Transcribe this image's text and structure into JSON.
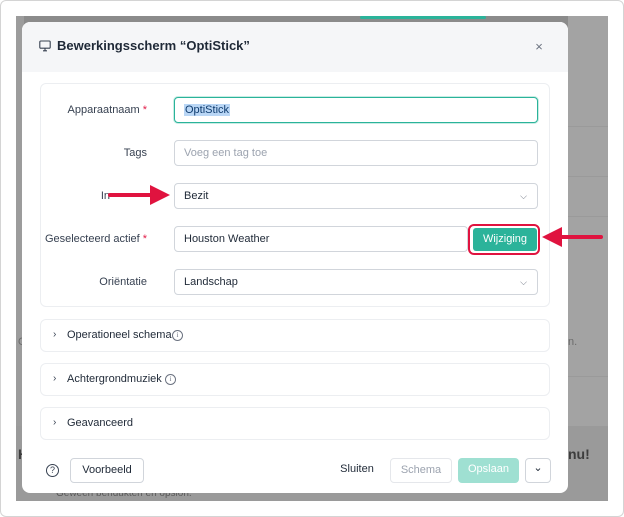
{
  "modal": {
    "title": "Bewerkingsscherm “OptiStick”",
    "close_label": "×"
  },
  "form": {
    "device_name_label": "Apparaatnaam",
    "device_name_value": "OptiStick",
    "tags_label": "Tags",
    "tags_placeholder": "Voeg een tag toe",
    "content_label_partial": "In",
    "content_value": "Bezit",
    "asset_label": "Geselecteerd actief",
    "asset_value": "Houston Weather",
    "change_button": "Wijziging",
    "orientation_label": "Oriëntatie",
    "orientation_value": "Landschap",
    "required_mark": "*"
  },
  "sections": [
    {
      "label": "Operationeel schema",
      "has_info": true
    },
    {
      "label": "Achtergrondmuziek",
      "has_info": true
    },
    {
      "label": "Geavanceerd",
      "has_info": false
    }
  ],
  "footer": {
    "help_icon_glyph": "?",
    "preview_button": "Voorbeeld",
    "close_button": "Sluiten",
    "schema_button": "Schema",
    "save_button": "Opslaan",
    "dropdown_glyph": "⌄"
  },
  "background": {
    "left_text_1": "O",
    "left_text_2": "H",
    "right_text_1": "n.",
    "right_text_2": "nu!",
    "bottom_text": "Geween bendukten en opslon."
  },
  "colors": {
    "accent": "#2bb39a",
    "annotation": "#e0133f",
    "required": "#e11d48"
  },
  "icons": {
    "title": "monitor-icon",
    "chevron": "chevron-down-icon",
    "section": "chevron-right-icon",
    "info": "info-icon",
    "help": "question-circle-icon"
  }
}
